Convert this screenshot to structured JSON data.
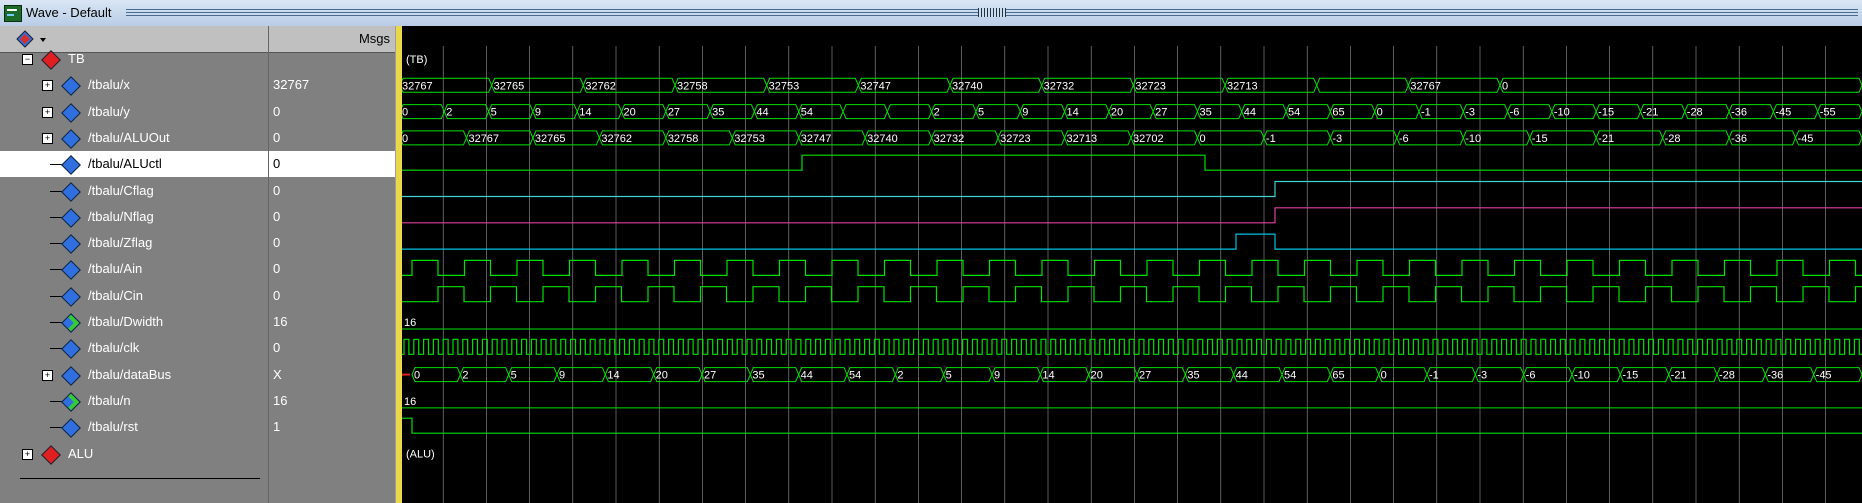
{
  "window": {
    "title": "Wave - Default"
  },
  "panes": {
    "msgs_header": "Msgs"
  },
  "signals": [
    {
      "name": "TB",
      "value": "",
      "indent": 0,
      "expand": "-",
      "icon": "red"
    },
    {
      "name": "/tbalu/x",
      "value": "32767",
      "indent": 1,
      "expand": "+",
      "icon": "blue"
    },
    {
      "name": "/tbalu/y",
      "value": "0",
      "indent": 1,
      "expand": "+",
      "icon": "blue"
    },
    {
      "name": "/tbalu/ALUOut",
      "value": "0",
      "indent": 1,
      "expand": "+",
      "icon": "blue"
    },
    {
      "name": "/tbalu/ALUctl",
      "value": "0",
      "indent": 1,
      "expand": "",
      "icon": "blue",
      "selected": true
    },
    {
      "name": "/tbalu/Cflag",
      "value": "0",
      "indent": 1,
      "expand": "",
      "icon": "blue"
    },
    {
      "name": "/tbalu/Nflag",
      "value": "0",
      "indent": 1,
      "expand": "",
      "icon": "blue"
    },
    {
      "name": "/tbalu/Zflag",
      "value": "0",
      "indent": 1,
      "expand": "",
      "icon": "blue"
    },
    {
      "name": "/tbalu/Ain",
      "value": "0",
      "indent": 1,
      "expand": "",
      "icon": "blue"
    },
    {
      "name": "/tbalu/Cin",
      "value": "0",
      "indent": 1,
      "expand": "",
      "icon": "blue"
    },
    {
      "name": "/tbalu/Dwidth",
      "value": "16",
      "indent": 1,
      "expand": "",
      "icon": "blue-green"
    },
    {
      "name": "/tbalu/clk",
      "value": "0",
      "indent": 1,
      "expand": "",
      "icon": "blue"
    },
    {
      "name": "/tbalu/dataBus",
      "value": "X",
      "indent": 1,
      "expand": "+",
      "icon": "blue"
    },
    {
      "name": "/tbalu/n",
      "value": "16",
      "indent": 1,
      "expand": "",
      "icon": "blue-green"
    },
    {
      "name": "/tbalu/rst",
      "value": "1",
      "indent": 1,
      "expand": "",
      "icon": "blue"
    },
    {
      "name": "ALU",
      "value": "",
      "indent": 0,
      "expand": "+",
      "icon": "red"
    }
  ],
  "waves": {
    "tb_label": "(TB)",
    "alu_label": "(ALU)",
    "x_bus": [
      "32767",
      "32765",
      "32762",
      "32758",
      "32753",
      "32747",
      "32740",
      "32732",
      "32723",
      "32713",
      "",
      "32767",
      "0"
    ],
    "y_bus": [
      "0",
      "2",
      "5",
      "9",
      "14",
      "20",
      "27",
      "35",
      "44",
      "54",
      "",
      "",
      "2",
      "5",
      "9",
      "14",
      "20",
      "27",
      "35",
      "44",
      "54",
      "65",
      "0",
      "-1",
      "-3",
      "-6",
      "-10",
      "-15",
      "-21",
      "-28",
      "-36",
      "-45",
      "-55"
    ],
    "aluout_bus": [
      "0",
      "32767",
      "32765",
      "32762",
      "32758",
      "32753",
      "32747",
      "32740",
      "32732",
      "32723",
      "32713",
      "32702",
      "0",
      "-1",
      "-3",
      "-6",
      "-10",
      "-15",
      "-21",
      "-28",
      "-36",
      "-45"
    ],
    "databus_bus": [
      "0",
      "2",
      "5",
      "9",
      "14",
      "20",
      "27",
      "35",
      "44",
      "54",
      "2",
      "5",
      "9",
      "14",
      "20",
      "27",
      "35",
      "44",
      "54",
      "65",
      "0",
      "-1",
      "-3",
      "-6",
      "-10",
      "-15",
      "-21",
      "-28",
      "-36",
      "-45"
    ],
    "dwidth_value": "16",
    "n_value": "16"
  },
  "colors": {
    "wave_green": "#00e000",
    "cflag": "#40d0d0",
    "nflag": "#e040a0",
    "zflag": "#00c0e0",
    "cursor": "#e8d84a"
  }
}
